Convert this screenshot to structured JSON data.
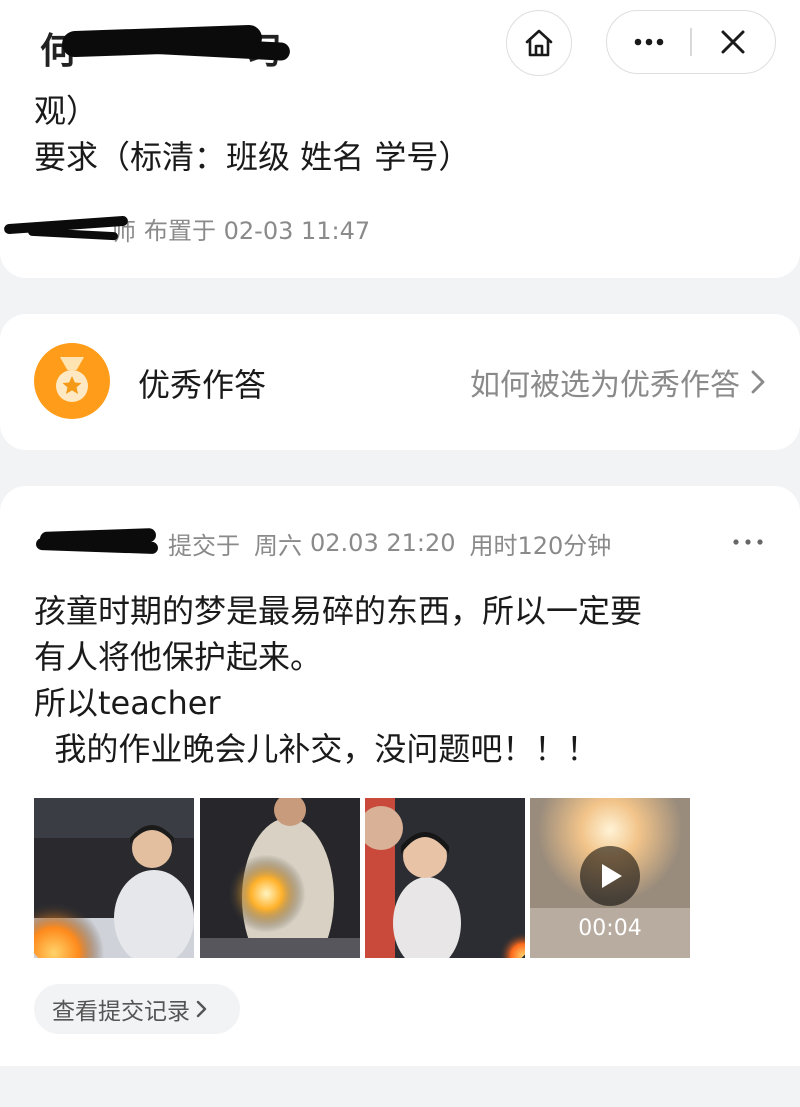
{
  "header": {
    "title_partial": "何",
    "title_tail": "习",
    "home_icon": "home-icon",
    "more_icon": "more-icon",
    "close_icon": "close-icon"
  },
  "assignment": {
    "desc_line1": "观）",
    "desc_line2": "要求（标清：班级 姓名 学号）",
    "teacher_suffix": "师",
    "assigned_text": "布置于 02-03 11:47"
  },
  "excellent": {
    "title": "优秀作答",
    "link_text": "如何被选为优秀作答",
    "icon": "medal-icon",
    "accent": "#ff9d1a"
  },
  "submission": {
    "submitted_label": "提交于",
    "day": "周六",
    "datetime": "02.03 21:20",
    "time_used": "用时120分钟",
    "text_lines": [
      "孩童时期的梦是最易碎的东西，所以一定要",
      "有人将他保护起来。",
      "所以teacher",
      "  我的作业晚会儿补交，没问题吧！！！"
    ],
    "video_duration": "00:04",
    "view_records": "查看提交记录"
  }
}
